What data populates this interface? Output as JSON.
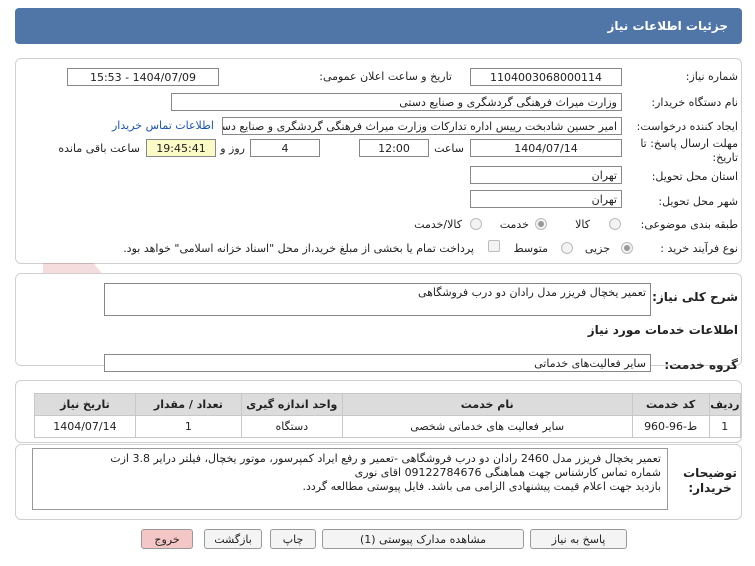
{
  "header": {
    "title": "جزئیات اطلاعات نیاز"
  },
  "form": {
    "need_number_label": "شماره نیاز:",
    "need_number": "1104003068000114",
    "announce_label": "تاریخ و ساعت اعلان عمومی:",
    "announce_value": "1404/07/09 - 15:53",
    "buyer_org_label": "نام دستگاه خریدار:",
    "buyer_org": "وزارت میراث فرهنگی  گردشگری و صنایع دستی",
    "creator_label": "ایجاد کننده درخواست:",
    "creator": "امیر حسین شادبخت رییس اداره تدارکات وزارت میراث فرهنگی  گردشگری و صنایع دستی",
    "contact_link": "اطلاعات تماس خریدار",
    "deadline_label": "مهلت ارسال پاسخ: تا تاریخ:",
    "deadline_date": "1404/07/14",
    "time_label": "ساعت",
    "deadline_time": "12:00",
    "days_value": "4",
    "days_label": "روز و",
    "remaining_time": "19:45:41",
    "remaining_label": "ساعت باقی مانده",
    "province_label": "استان محل تحویل:",
    "province": "تهران",
    "city_label": "شهر محل تحویل:",
    "city": "تهران",
    "category_label": "طبقه بندی موضوعی:",
    "category_options": [
      "کالا",
      "خدمت",
      "کالا/خدمت"
    ],
    "category_selected": "خدمت",
    "process_label": "نوع فرآیند خرید :",
    "process_options": [
      "جزیی",
      "متوسط"
    ],
    "process_selected": "جزیی",
    "payment_note": "پرداخت تمام یا بخشی از مبلغ خرید،از محل \"اسناد خزانه اسلامی\" خواهد بود."
  },
  "summary": {
    "label": "شرح کلی نیاز:",
    "text": "تعمیر یخچال فریزر مدل رادان دو درب فروشگاهی"
  },
  "services": {
    "section_title": "اطلاعات خدمات مورد نیاز",
    "group_label": "گروه خدمت:",
    "group_value": "سایر فعالیت‌های خدماتی",
    "columns": [
      "ردیف",
      "کد خدمت",
      "نام خدمت",
      "واحد اندازه گیری",
      "تعداد / مقدار",
      "تاریخ نیاز"
    ],
    "rows": [
      [
        "1",
        "ط-96-960",
        "سایر فعالیت های خدماتی شخصی",
        "دستگاه",
        "1",
        "1404/07/14"
      ]
    ]
  },
  "description": {
    "label_line1": "توضیحات",
    "label_line2": "خریدار:",
    "lines": [
      "تعمیر یخچال فریزر مدل 2460 رادان دو درب فروشگاهی -تعمیر و رفع ایراد کمپرسور، موتور یخچال، فیلتر درایر 3.8 ازت",
      "شماره تماس کارشناس جهت هماهنگی 09122784676 اقای نوری",
      "بازدید جهت اعلام قیمت پیشنهادی الزامی می باشد. فایل پیوستی مطالعه گردد."
    ]
  },
  "buttons": {
    "respond": "پاسخ به نیاز",
    "attachments": "مشاهده مدارک پیوستی (1)",
    "print": "چاپ",
    "back": "بازگشت",
    "exit": "خروج"
  },
  "watermark": {
    "text": "AriaTender.net"
  },
  "colors": {
    "header_bg": "#4f76a6",
    "link": "#1a55b0",
    "highlight": "#fbfbc8",
    "exit_bg": "#f5c6c6"
  }
}
